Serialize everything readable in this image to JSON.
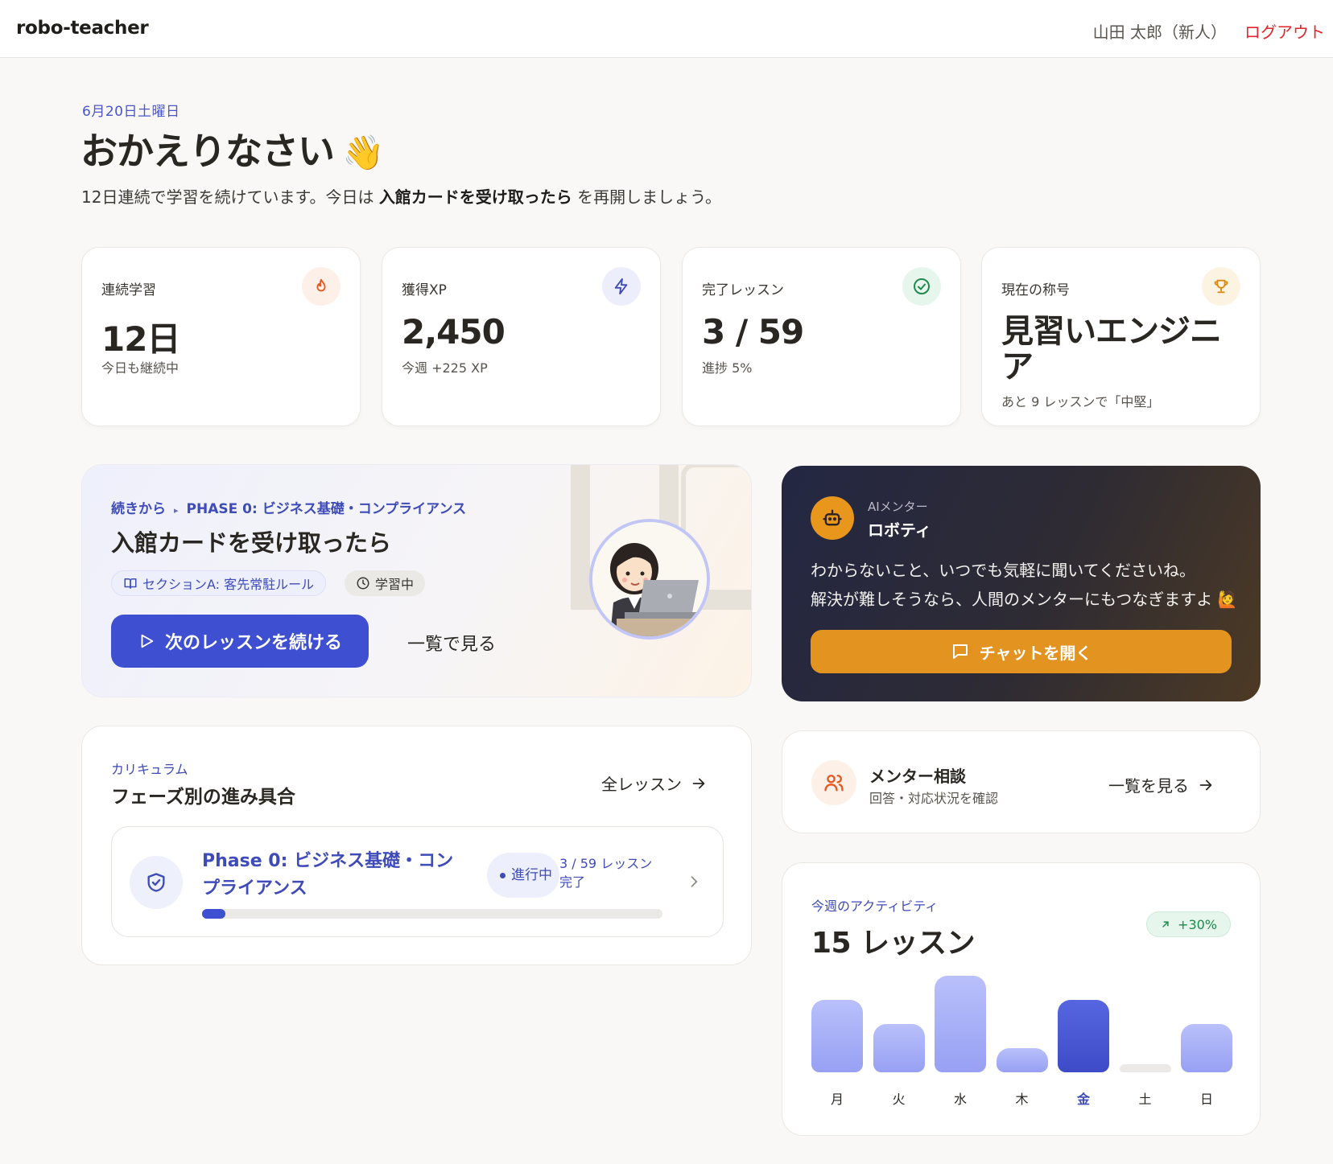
{
  "header": {
    "brand": "robo-teacher",
    "user": "山田 太郎（新人）",
    "logout": "ログアウト"
  },
  "hero": {
    "date": "6月20日土曜日",
    "greeting": "おかえりなさい",
    "wave_emoji": "👋",
    "subtitle_pre": "12日連続で学習を続けています。今日は ",
    "subtitle_bold": "入館カードを受け取ったら",
    "subtitle_post": " を再開しましょう。"
  },
  "stats": [
    {
      "label": "連続学習",
      "value": "12日",
      "sub": "今日も継続中",
      "icon": "flame-icon",
      "color": "#e8551f",
      "bg": "#fdf0e8"
    },
    {
      "label": "獲得XP",
      "value": "2,450",
      "sub": "今週 +225 XP",
      "icon": "bolt-icon",
      "color": "#3e4bb8",
      "bg": "#eceefb"
    },
    {
      "label": "完了レッスン",
      "value": "3 / 59",
      "sub": "進捗 5%",
      "icon": "check-circle-icon",
      "color": "#1f8a4c",
      "bg": "#e7f6ed"
    },
    {
      "label": "現在の称号",
      "value": "見習いエンジニア",
      "sub": "あと 9 レッスンで「中堅」",
      "icon": "trophy-icon",
      "color": "#d98a12",
      "bg": "#fdf3e2"
    }
  ],
  "continue": {
    "crumb_a": "続きから",
    "crumb_b": "PHASE 0: ビジネス基礎・コンプライアンス",
    "title": "入館カードを受け取ったら",
    "section_chip": "セクションA: 客先常駐ルール",
    "status_chip": "学習中",
    "primary_button": "次のレッスンを続ける",
    "secondary_link": "一覧で見る"
  },
  "mentor": {
    "kicker": "AIメンター",
    "name": "ロボティ",
    "message_line1": "わからないこと、いつでも気軽に聞いてくださいね。",
    "message_line2": "解決が難しそうなら、人間のメンターにもつなぎますよ 🙋",
    "chat_button": "チャットを開く"
  },
  "curriculum": {
    "kicker": "カリキュラム",
    "title": "フェーズ別の進み具合",
    "all_link": "全レッスン",
    "phases": [
      {
        "name": "Phase 0: ビジネス基礎・コンプライアンス",
        "status": "進行中",
        "count": "3 / 59 レッスン完了",
        "progress": 0.05
      }
    ]
  },
  "consult": {
    "title": "メンター相談",
    "sub": "回答・対応状況を確認",
    "link": "一覧を見る"
  },
  "activity": {
    "kicker": "今週のアクティビティ",
    "total": "15 レッスン",
    "trend": "+30%",
    "days": [
      {
        "label": "月",
        "value": 3
      },
      {
        "label": "火",
        "value": 2
      },
      {
        "label": "水",
        "value": 4
      },
      {
        "label": "木",
        "value": 1
      },
      {
        "label": "金",
        "value": 3,
        "today": true
      },
      {
        "label": "土",
        "value": 0
      },
      {
        "label": "日",
        "value": 2
      }
    ]
  }
}
